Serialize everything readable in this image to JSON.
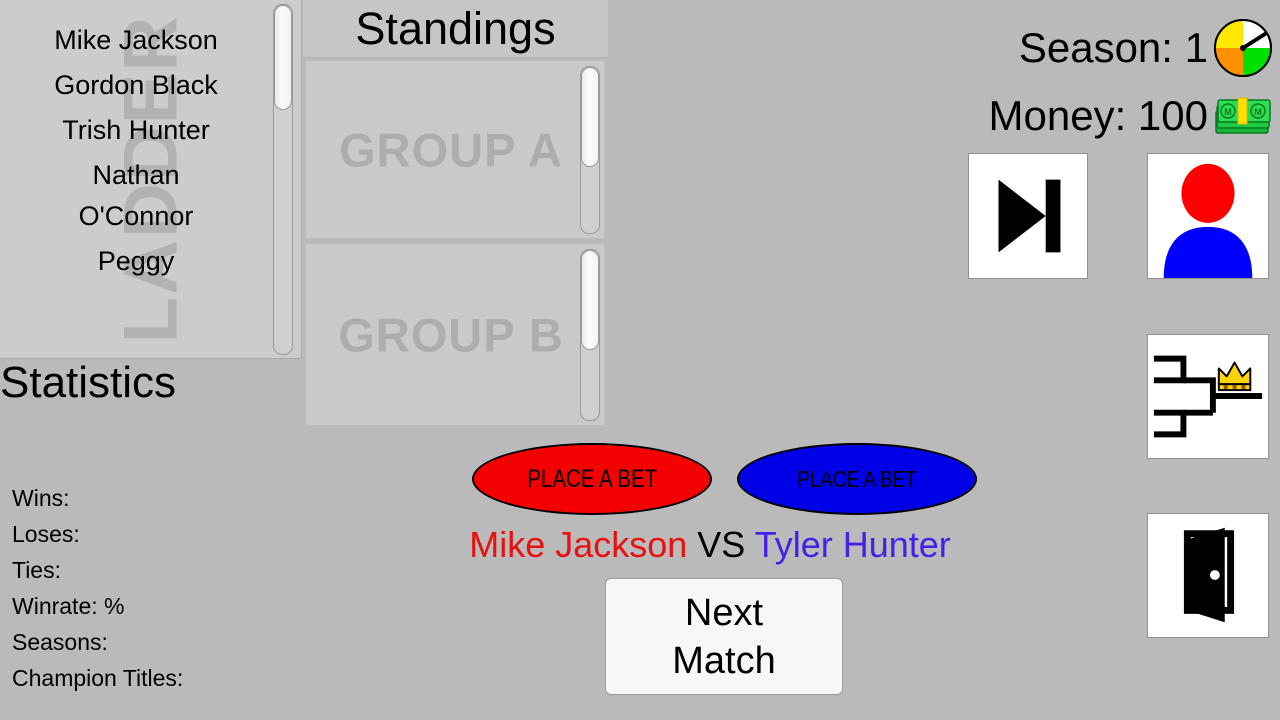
{
  "app": {
    "background_color": "#bababa"
  },
  "ladder": {
    "watermark": "LADDER",
    "players": [
      {
        "name": "Mike Jackson"
      },
      {
        "name": "Gordon Black"
      },
      {
        "name": "Trish Hunter"
      },
      {
        "name": "Nathan\nO'Connor"
      },
      {
        "name": "Peggy"
      }
    ],
    "scrollbar": {
      "name": "ladder-scrollbar"
    }
  },
  "statistics": {
    "title": "Statistics",
    "lines": [
      {
        "label": "Wins:"
      },
      {
        "label": "Loses:"
      },
      {
        "label": "Ties:"
      },
      {
        "label": "Winrate: %"
      },
      {
        "label": "Seasons:"
      },
      {
        "label": "Champion Titles:"
      }
    ]
  },
  "standings": {
    "title": "Standings",
    "groups": [
      {
        "label": "GROUP A"
      },
      {
        "label": "GROUP B"
      }
    ]
  },
  "hud": {
    "season_label": "Season: 1",
    "money_label": "Money: 100",
    "season_icon": "clock-pie-icon",
    "money_icon": "money-stack-icon",
    "season_icon_colors": {
      "top_right": "#ffffff",
      "top_left": "#ffe800",
      "bottom_left": "#ff9000",
      "bottom_right": "#00e000"
    },
    "money_icon_colors": {
      "bill": "#22cc44",
      "band": "#ffe000"
    }
  },
  "match": {
    "bet_left_label": "PLACE A BET",
    "bet_right_label": "PLACE A BET",
    "bet_left_color": "#f50000",
    "bet_right_color": "#0000e6",
    "player_left": "Mike Jackson",
    "vs_word": " VS ",
    "player_right": "Tyler Hunter",
    "player_left_color": "#e81010",
    "player_right_color": "#4420e8",
    "next_match_label": "Next\nMatch"
  },
  "side_buttons": [
    {
      "name": "skip-button",
      "icon": "skip-forward-icon"
    },
    {
      "name": "profile-button",
      "icon": "user-avatar-icon"
    },
    {
      "name": "bracket-button",
      "icon": "tournament-bracket-crown-icon"
    },
    {
      "name": "exit-button",
      "icon": "exit-door-icon"
    }
  ]
}
